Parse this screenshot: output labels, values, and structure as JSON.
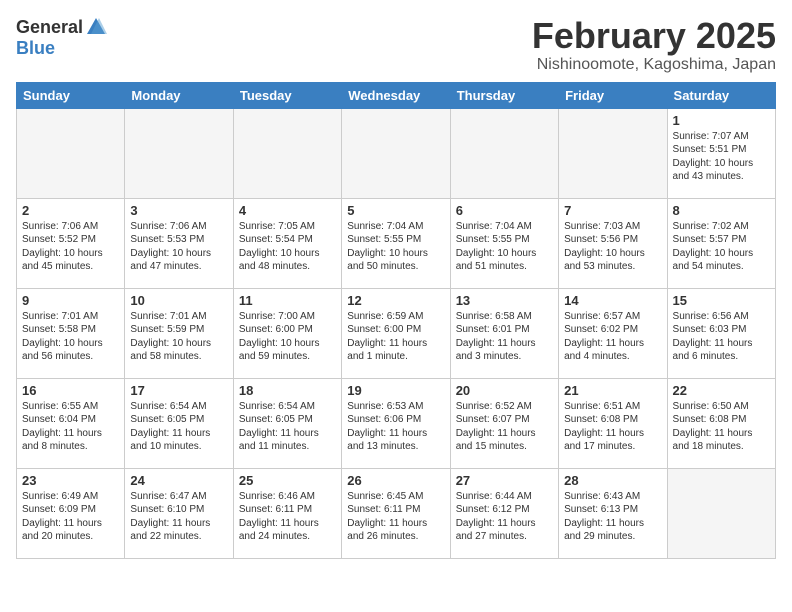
{
  "header": {
    "logo_general": "General",
    "logo_blue": "Blue",
    "month_title": "February 2025",
    "location": "Nishinoomote, Kagoshima, Japan"
  },
  "days_of_week": [
    "Sunday",
    "Monday",
    "Tuesday",
    "Wednesday",
    "Thursday",
    "Friday",
    "Saturday"
  ],
  "weeks": [
    [
      {
        "day": "",
        "info": ""
      },
      {
        "day": "",
        "info": ""
      },
      {
        "day": "",
        "info": ""
      },
      {
        "day": "",
        "info": ""
      },
      {
        "day": "",
        "info": ""
      },
      {
        "day": "",
        "info": ""
      },
      {
        "day": "1",
        "info": "Sunrise: 7:07 AM\nSunset: 5:51 PM\nDaylight: 10 hours and 43 minutes."
      }
    ],
    [
      {
        "day": "2",
        "info": "Sunrise: 7:06 AM\nSunset: 5:52 PM\nDaylight: 10 hours and 45 minutes."
      },
      {
        "day": "3",
        "info": "Sunrise: 7:06 AM\nSunset: 5:53 PM\nDaylight: 10 hours and 47 minutes."
      },
      {
        "day": "4",
        "info": "Sunrise: 7:05 AM\nSunset: 5:54 PM\nDaylight: 10 hours and 48 minutes."
      },
      {
        "day": "5",
        "info": "Sunrise: 7:04 AM\nSunset: 5:55 PM\nDaylight: 10 hours and 50 minutes."
      },
      {
        "day": "6",
        "info": "Sunrise: 7:04 AM\nSunset: 5:55 PM\nDaylight: 10 hours and 51 minutes."
      },
      {
        "day": "7",
        "info": "Sunrise: 7:03 AM\nSunset: 5:56 PM\nDaylight: 10 hours and 53 minutes."
      },
      {
        "day": "8",
        "info": "Sunrise: 7:02 AM\nSunset: 5:57 PM\nDaylight: 10 hours and 54 minutes."
      }
    ],
    [
      {
        "day": "9",
        "info": "Sunrise: 7:01 AM\nSunset: 5:58 PM\nDaylight: 10 hours and 56 minutes."
      },
      {
        "day": "10",
        "info": "Sunrise: 7:01 AM\nSunset: 5:59 PM\nDaylight: 10 hours and 58 minutes."
      },
      {
        "day": "11",
        "info": "Sunrise: 7:00 AM\nSunset: 6:00 PM\nDaylight: 10 hours and 59 minutes."
      },
      {
        "day": "12",
        "info": "Sunrise: 6:59 AM\nSunset: 6:00 PM\nDaylight: 11 hours and 1 minute."
      },
      {
        "day": "13",
        "info": "Sunrise: 6:58 AM\nSunset: 6:01 PM\nDaylight: 11 hours and 3 minutes."
      },
      {
        "day": "14",
        "info": "Sunrise: 6:57 AM\nSunset: 6:02 PM\nDaylight: 11 hours and 4 minutes."
      },
      {
        "day": "15",
        "info": "Sunrise: 6:56 AM\nSunset: 6:03 PM\nDaylight: 11 hours and 6 minutes."
      }
    ],
    [
      {
        "day": "16",
        "info": "Sunrise: 6:55 AM\nSunset: 6:04 PM\nDaylight: 11 hours and 8 minutes."
      },
      {
        "day": "17",
        "info": "Sunrise: 6:54 AM\nSunset: 6:05 PM\nDaylight: 11 hours and 10 minutes."
      },
      {
        "day": "18",
        "info": "Sunrise: 6:54 AM\nSunset: 6:05 PM\nDaylight: 11 hours and 11 minutes."
      },
      {
        "day": "19",
        "info": "Sunrise: 6:53 AM\nSunset: 6:06 PM\nDaylight: 11 hours and 13 minutes."
      },
      {
        "day": "20",
        "info": "Sunrise: 6:52 AM\nSunset: 6:07 PM\nDaylight: 11 hours and 15 minutes."
      },
      {
        "day": "21",
        "info": "Sunrise: 6:51 AM\nSunset: 6:08 PM\nDaylight: 11 hours and 17 minutes."
      },
      {
        "day": "22",
        "info": "Sunrise: 6:50 AM\nSunset: 6:08 PM\nDaylight: 11 hours and 18 minutes."
      }
    ],
    [
      {
        "day": "23",
        "info": "Sunrise: 6:49 AM\nSunset: 6:09 PM\nDaylight: 11 hours and 20 minutes."
      },
      {
        "day": "24",
        "info": "Sunrise: 6:47 AM\nSunset: 6:10 PM\nDaylight: 11 hours and 22 minutes."
      },
      {
        "day": "25",
        "info": "Sunrise: 6:46 AM\nSunset: 6:11 PM\nDaylight: 11 hours and 24 minutes."
      },
      {
        "day": "26",
        "info": "Sunrise: 6:45 AM\nSunset: 6:11 PM\nDaylight: 11 hours and 26 minutes."
      },
      {
        "day": "27",
        "info": "Sunrise: 6:44 AM\nSunset: 6:12 PM\nDaylight: 11 hours and 27 minutes."
      },
      {
        "day": "28",
        "info": "Sunrise: 6:43 AM\nSunset: 6:13 PM\nDaylight: 11 hours and 29 minutes."
      },
      {
        "day": "",
        "info": ""
      }
    ]
  ]
}
